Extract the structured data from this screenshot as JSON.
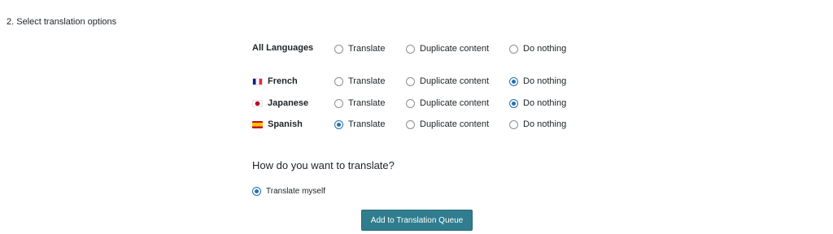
{
  "section": {
    "title": "2. Select translation options"
  },
  "options": {
    "translate": "Translate",
    "duplicate": "Duplicate content",
    "nothing": "Do nothing"
  },
  "languages": [
    {
      "label": "All Languages",
      "flag": "",
      "selected": "none"
    },
    {
      "label": "French",
      "flag": "flag-fr-icon",
      "selected": "nothing"
    },
    {
      "label": "Japanese",
      "flag": "flag-jp-icon",
      "selected": "nothing"
    },
    {
      "label": "Spanish",
      "flag": "flag-es-icon",
      "selected": "translate"
    }
  ],
  "method": {
    "question": "How do you want to translate?",
    "option_label": "Translate myself",
    "selected": true
  },
  "actions": {
    "queue_label": "Add to Translation Queue"
  },
  "colors": {
    "accent": "#2271b1",
    "button": "#2f7d8e"
  }
}
